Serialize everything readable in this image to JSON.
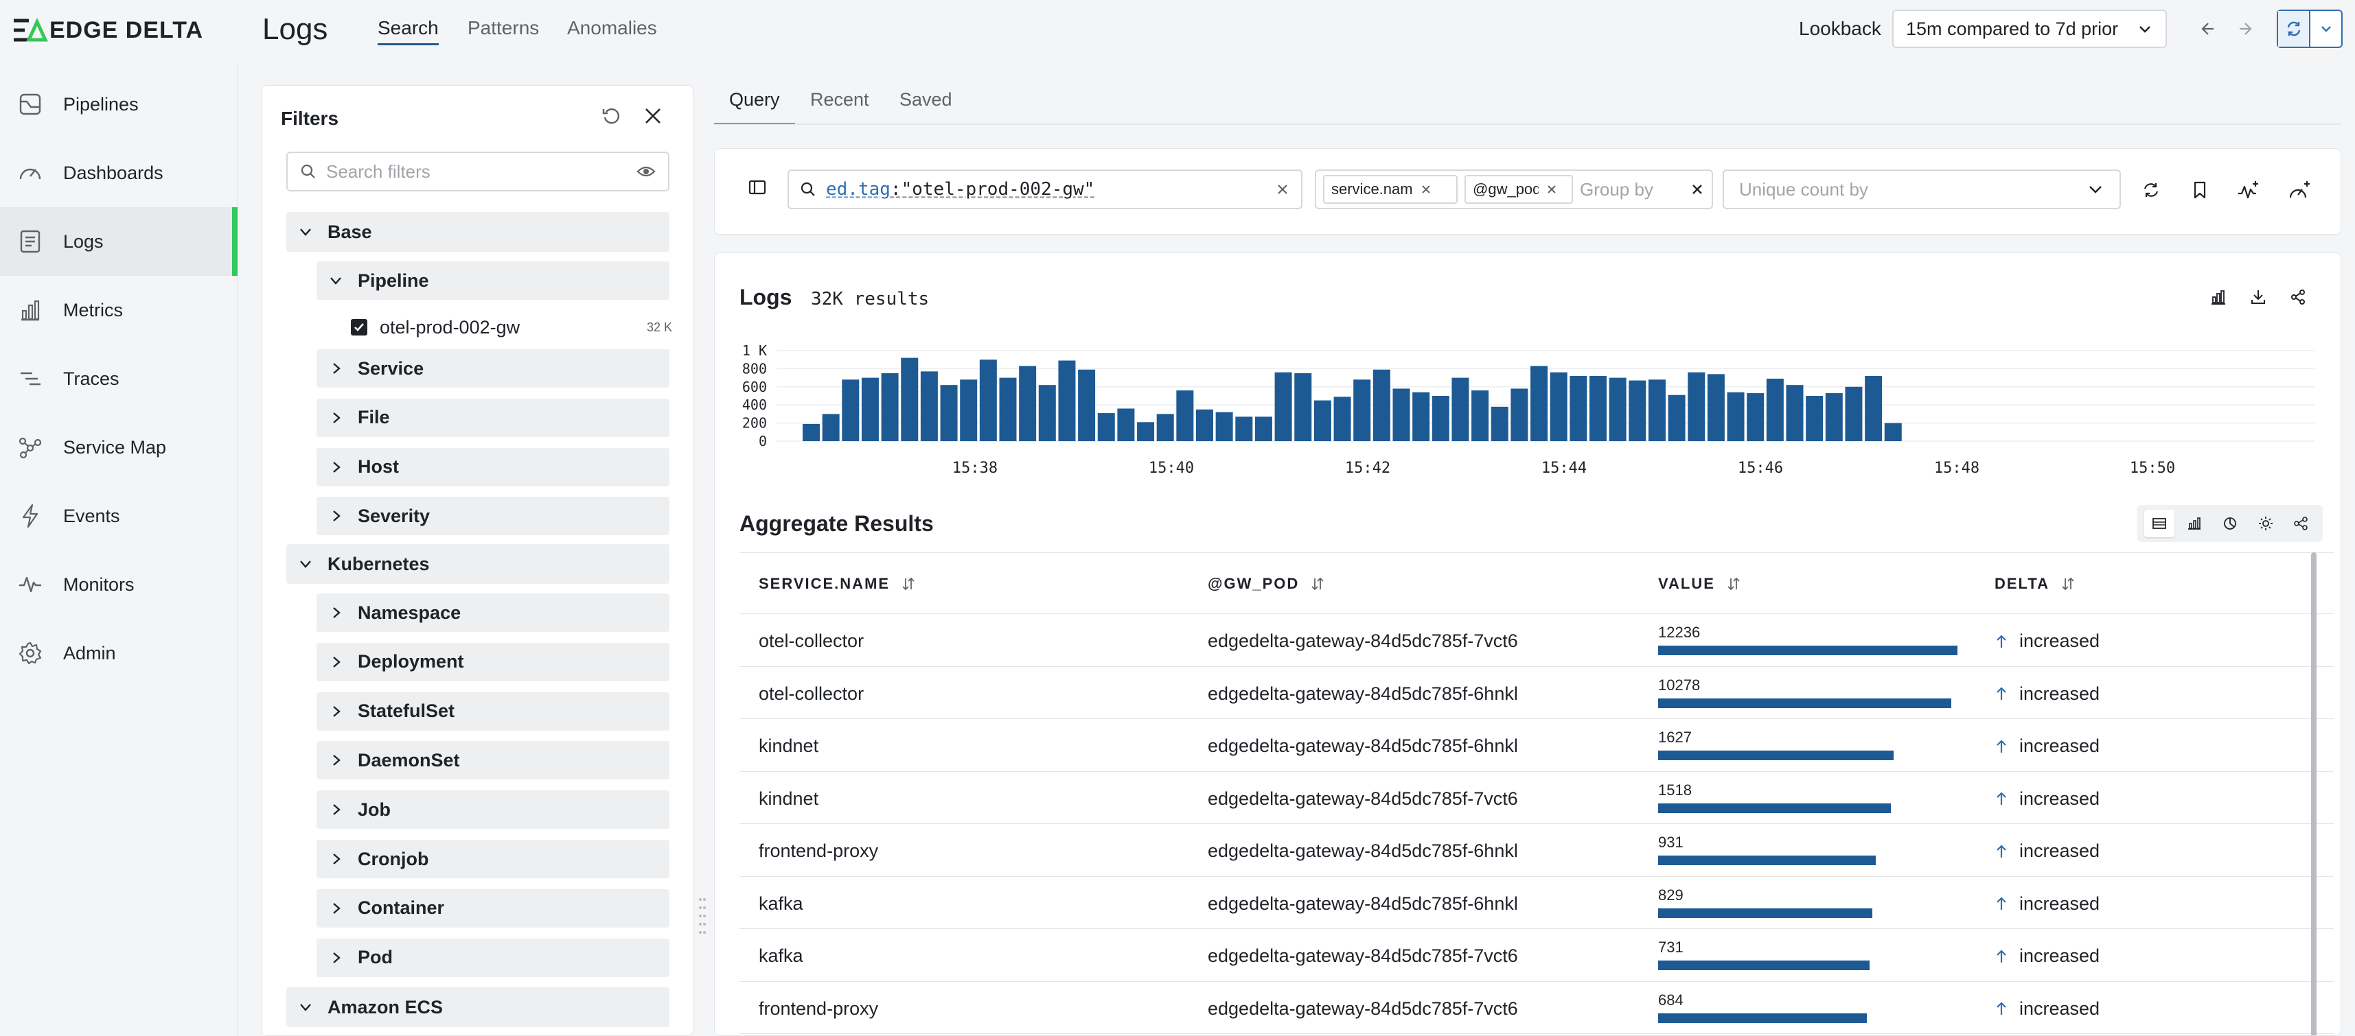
{
  "brand": {
    "name": "EDGE DELTA",
    "accent": "#34c759",
    "primary": "#1d5a94"
  },
  "header": {
    "title": "Logs",
    "tabs": [
      {
        "label": "Search",
        "active": true
      },
      {
        "label": "Patterns"
      },
      {
        "label": "Anomalies"
      }
    ],
    "lookback_label": "Lookback",
    "lookback_value": "15m compared to 7d prior"
  },
  "sidebar": {
    "items": [
      {
        "label": "Pipelines",
        "icon": "pipelines-icon"
      },
      {
        "label": "Dashboards",
        "icon": "dashboard-gauge-icon"
      },
      {
        "label": "Logs",
        "icon": "logs-icon",
        "active": true
      },
      {
        "label": "Metrics",
        "icon": "metrics-bar-icon"
      },
      {
        "label": "Traces",
        "icon": "traces-icon"
      },
      {
        "label": "Service Map",
        "icon": "service-map-icon"
      },
      {
        "label": "Events",
        "icon": "lightning-icon"
      },
      {
        "label": "Monitors",
        "icon": "pulse-icon"
      },
      {
        "label": "Admin",
        "icon": "gear-icon"
      }
    ]
  },
  "filters": {
    "title": "Filters",
    "search_placeholder": "Search filters",
    "base": "Base",
    "pipeline": "Pipeline",
    "pipeline_value": "otel-prod-002-gw",
    "pipeline_count": "32 K",
    "base_children": [
      "Service",
      "File",
      "Host",
      "Severity"
    ],
    "kubernetes": "Kubernetes",
    "k8s_children": [
      "Namespace",
      "Deployment",
      "StatefulSet",
      "DaemonSet",
      "Job",
      "Cronjob",
      "Container",
      "Pod"
    ],
    "amazon_ecs": "Amazon ECS"
  },
  "query_tabs": [
    {
      "label": "Query",
      "active": true
    },
    {
      "label": "Recent"
    },
    {
      "label": "Saved"
    }
  ],
  "query": {
    "key": "ed.tag",
    "value": ":\"otel-prod-002-gw\"",
    "group_chips": [
      "service.nam",
      "@gw_pod"
    ],
    "group_placeholder": "Group by",
    "unique_placeholder": "Unique count by"
  },
  "logs": {
    "title": "Logs",
    "count": "32K results"
  },
  "chart_data": {
    "type": "bar",
    "yticks": [
      "1 K",
      "800",
      "600",
      "400",
      "200",
      "0"
    ],
    "ylim": [
      0,
      1000
    ],
    "xticks": [
      "15:38",
      "15:40",
      "15:42",
      "15:44",
      "15:46",
      "15:48",
      "15:50"
    ],
    "color": "#1d5a94",
    "values": [
      190,
      300,
      680,
      700,
      750,
      920,
      770,
      620,
      680,
      900,
      700,
      830,
      620,
      890,
      790,
      310,
      360,
      210,
      300,
      560,
      350,
      320,
      270,
      270,
      760,
      750,
      450,
      490,
      680,
      790,
      580,
      540,
      500,
      700,
      560,
      380,
      580,
      830,
      760,
      720,
      720,
      700,
      670,
      680,
      510,
      760,
      740,
      540,
      530,
      690,
      620,
      500,
      530,
      600,
      720,
      200
    ]
  },
  "aggregate": {
    "title": "Aggregate Results",
    "columns": [
      "SERVICE.NAME",
      "@GW_POD",
      "VALUE",
      "DELTA"
    ],
    "max_value": 12236,
    "rows": [
      {
        "service": "otel-collector",
        "pod": "edgedelta-gateway-84d5dc785f-7vct6",
        "value": "12236",
        "value_num": 12236,
        "bar_fraction": 0.99,
        "delta": "increased"
      },
      {
        "service": "otel-collector",
        "pod": "edgedelta-gateway-84d5dc785f-6hnkl",
        "value": "10278",
        "value_num": 10278,
        "bar_fraction": 0.97,
        "delta": "increased"
      },
      {
        "service": "kindnet",
        "pod": "edgedelta-gateway-84d5dc785f-6hnkl",
        "value": "1627",
        "value_num": 1627,
        "bar_fraction": 0.78,
        "delta": "increased"
      },
      {
        "service": "kindnet",
        "pod": "edgedelta-gateway-84d5dc785f-7vct6",
        "value": "1518",
        "value_num": 1518,
        "bar_fraction": 0.77,
        "delta": "increased"
      },
      {
        "service": "frontend-proxy",
        "pod": "edgedelta-gateway-84d5dc785f-6hnkl",
        "value": "931",
        "value_num": 931,
        "bar_fraction": 0.72,
        "delta": "increased"
      },
      {
        "service": "kafka",
        "pod": "edgedelta-gateway-84d5dc785f-6hnkl",
        "value": "829",
        "value_num": 829,
        "bar_fraction": 0.71,
        "delta": "increased"
      },
      {
        "service": "kafka",
        "pod": "edgedelta-gateway-84d5dc785f-7vct6",
        "value": "731",
        "value_num": 731,
        "bar_fraction": 0.7,
        "delta": "increased"
      },
      {
        "service": "frontend-proxy",
        "pod": "edgedelta-gateway-84d5dc785f-7vct6",
        "value": "684",
        "value_num": 684,
        "bar_fraction": 0.69,
        "delta": "increased"
      }
    ]
  }
}
